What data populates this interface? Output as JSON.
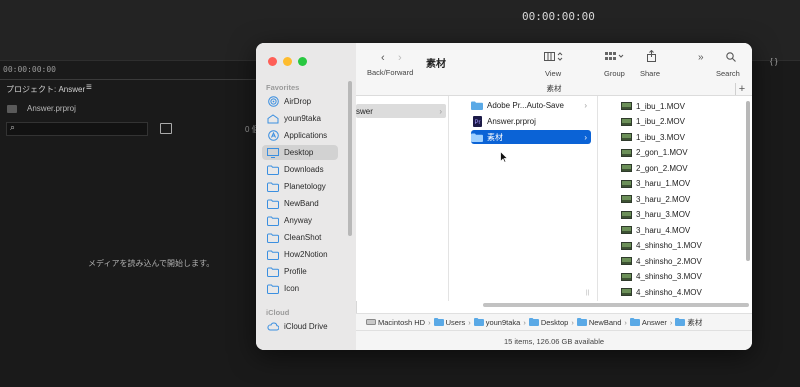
{
  "background": {
    "timecode": "00:00:00:00",
    "small_timecode": "00:00:00:00",
    "panel_title": "プロジェクト: Answer",
    "project_file": "Answer.prproj",
    "item_count": "0 個",
    "empty_message": "メディアを読み込んで開始します。",
    "braces": "{ }"
  },
  "finder": {
    "title": "素材",
    "toolbar": {
      "nav_label": "Back/Forward",
      "view_label": "View",
      "group_label": "Group",
      "share_label": "Share",
      "search_label": "Search"
    },
    "tab_label": "素材",
    "sidebar": {
      "favorites_heading": "Favorites",
      "icloud_heading": "iCloud",
      "favorites": [
        {
          "label": "AirDrop",
          "icon": "airdrop-icon"
        },
        {
          "label": "youn9taka",
          "icon": "home-folder-icon"
        },
        {
          "label": "Applications",
          "icon": "applications-icon"
        },
        {
          "label": "Desktop",
          "icon": "desktop-icon",
          "selected": true
        },
        {
          "label": "Downloads",
          "icon": "folder-icon"
        },
        {
          "label": "Planetology",
          "icon": "folder-icon"
        },
        {
          "label": "NewBand",
          "icon": "folder-icon"
        },
        {
          "label": "Anyway",
          "icon": "folder-icon"
        },
        {
          "label": "CleanShot",
          "icon": "folder-icon"
        },
        {
          "label": "How2Notion",
          "icon": "folder-icon"
        },
        {
          "label": "Profile",
          "icon": "folder-icon"
        },
        {
          "label": "Icon",
          "icon": "folder-icon"
        }
      ],
      "icloud": [
        {
          "label": "iCloud Drive",
          "icon": "cloud-icon"
        }
      ]
    },
    "col1": {
      "selected": "swer"
    },
    "col2": [
      {
        "label": "Adobe Pr...Auto-Save",
        "type": "folder"
      },
      {
        "label": "Answer.prproj",
        "type": "premiere"
      },
      {
        "label": "素材",
        "type": "folder",
        "active": true
      }
    ],
    "col3": [
      "1_ibu_1.MOV",
      "1_ibu_2.MOV",
      "1_ibu_3.MOV",
      "2_gon_1.MOV",
      "2_gon_2.MOV",
      "3_haru_1.MOV",
      "3_haru_2.MOV",
      "3_haru_3.MOV",
      "3_haru_4.MOV",
      "4_shinsho_1.MOV",
      "4_shinsho_2.MOV",
      "4_shinsho_3.MOV",
      "4_shinsho_4.MOV"
    ],
    "path": [
      "Macintosh HD",
      "Users",
      "youn9taka",
      "Desktop",
      "NewBand",
      "Answer",
      "素材"
    ],
    "status": "15 items, 126.06 GB available",
    "colors": {
      "accent": "#0b63d6",
      "folder": "#5aa9e6"
    }
  }
}
